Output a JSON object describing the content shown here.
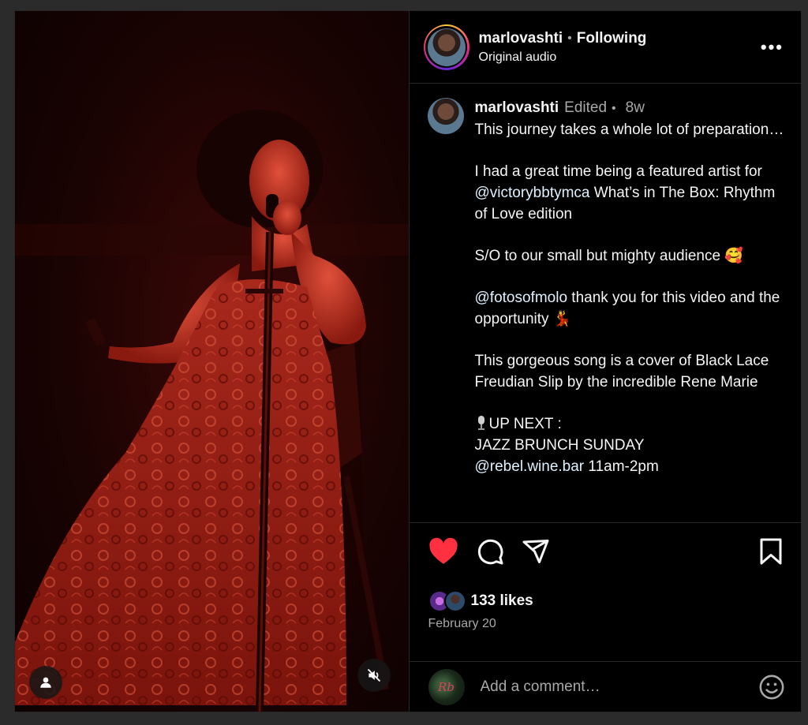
{
  "post": {
    "username": "marlovashti",
    "follow_status": "Following",
    "audio": "Original audio",
    "more_label": "•••"
  },
  "caption": {
    "username": "marlovashti",
    "edited": "Edited",
    "age": "8w",
    "line1": "This journey takes a whole lot of preparation…",
    "line2_pre": "I had a great time being a featured artist for ",
    "mention1": "@victorybbtymca",
    "line2_post": " What’s in The Box: Rhythm of Love edition",
    "line3": "S/O to our small but mighty audience 🥰",
    "mention2": "@fotosofmolo",
    "line4_post": " thank you for this video and the opportunity 💃",
    "line5": "This gorgeous song is a cover of Black Lace Freudian Slip by the incredible Rene Marie",
    "up_next": "UP NEXT :",
    "event": "JAZZ BRUNCH SUNDAY",
    "mention3": "@rebel.wine.bar",
    "event_time": " 11am-2pm"
  },
  "stats": {
    "likes": "133 likes",
    "date": "February 20"
  },
  "comment": {
    "placeholder": "Add a comment…",
    "avatar_text": "Rb"
  },
  "colors": {
    "like": "#ff3040",
    "mention": "#e0f1ff",
    "secondary_text": "#a8a8a8"
  },
  "icons": [
    "user-tag-icon",
    "muted-speaker-icon",
    "heart-icon",
    "comment-icon",
    "share-icon",
    "bookmark-icon",
    "emoji-icon",
    "more-icon",
    "microphone-icon"
  ]
}
